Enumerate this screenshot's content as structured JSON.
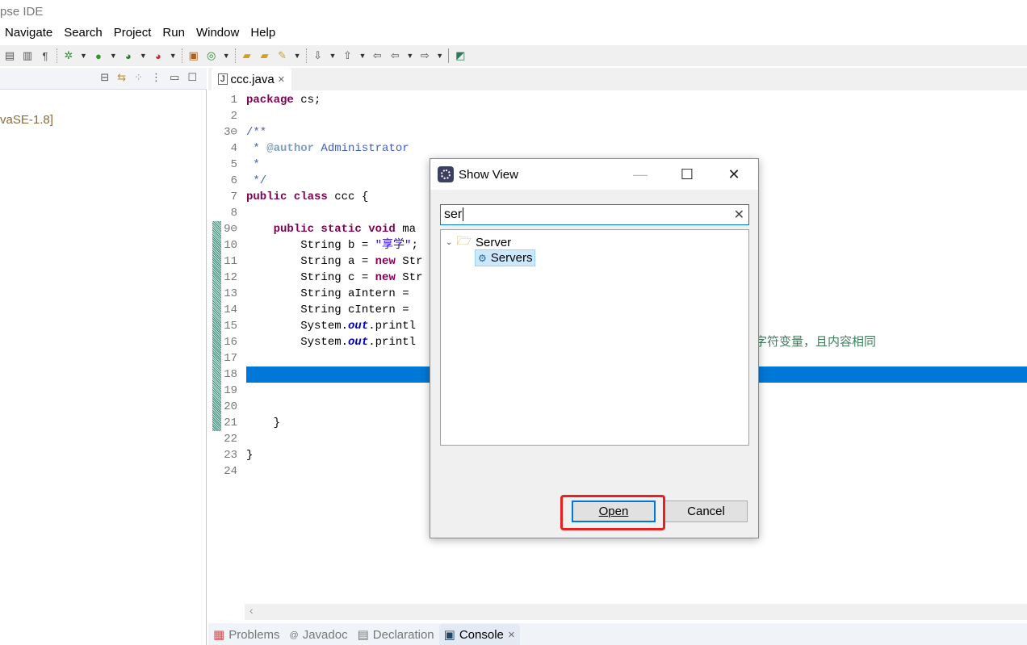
{
  "window": {
    "title": "pse IDE"
  },
  "menu": [
    "Navigate",
    "Search",
    "Project",
    "Run",
    "Window",
    "Help"
  ],
  "left_panel": {
    "jre_label": "vaSE-1.8]"
  },
  "editor": {
    "tab_label": "ccc.java",
    "line_numbers": [
      "1",
      "2",
      "3⊖",
      "4",
      "5",
      "6",
      "7",
      "8",
      "9⊖",
      "10",
      "11",
      "12",
      "13",
      "14",
      "15",
      "16",
      "17",
      "18",
      "19",
      "20",
      "21",
      "22",
      "23",
      "24"
    ],
    "line16_comment_visible": "字符变量，且内容相同",
    "highlighted_line": 18
  },
  "bottom_tabs": [
    "Problems",
    "Javadoc",
    "Declaration",
    "Console"
  ],
  "dialog": {
    "title": "Show View",
    "filter_value": "ser",
    "tree": {
      "category": "Server",
      "item": "Servers"
    },
    "open_label": "Open",
    "cancel_label": "Cancel",
    "highlight_color": "#e8211e"
  }
}
